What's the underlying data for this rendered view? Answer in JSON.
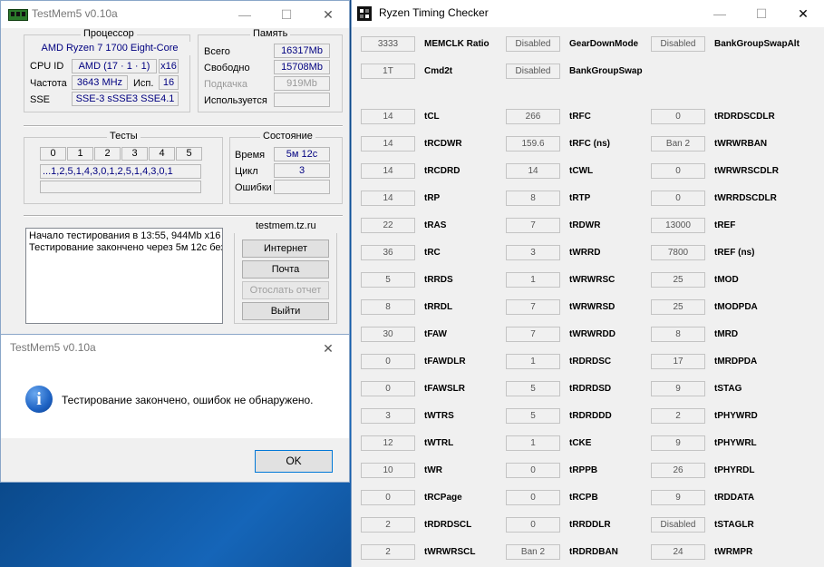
{
  "testmem": {
    "title": "TestMem5 v0.10a",
    "processor": {
      "group_title": "Процессор",
      "name": "AMD Ryzen 7 1700 Eight-Core",
      "cpuid_label": "CPU ID",
      "cpuid_value": "AMD  (17 · 1 · 1)",
      "cores_value": "x16",
      "freq_label": "Частота",
      "freq_value": "3643 MHz",
      "use_label": "Исп.",
      "use_value": "16",
      "sse_label": "SSE",
      "sse_value": "SSE-3 sSSE3 SSE4.1"
    },
    "memory": {
      "group_title": "Память",
      "total_label": "Всего",
      "total_value": "16317Mb",
      "free_label": "Свободно",
      "free_value": "15708Mb",
      "swap_label": "Подкачка",
      "swap_value": "919Mb",
      "used_label": "Используется",
      "used_value": ""
    },
    "tests": {
      "group_title": "Тесты",
      "columns": [
        "0",
        "1",
        "2",
        "3",
        "4",
        "5"
      ],
      "sequence": "...1,2,5,1,4,3,0,1,2,5,1,4,3,0,1"
    },
    "state": {
      "group_title": "Состояние",
      "time_label": "Время",
      "time_value": "5м 12с",
      "cycle_label": "Цикл",
      "cycle_value": "3",
      "errors_label": "Ошибки",
      "errors_value": ""
    },
    "log": [
      "Начало тестирования в 13:55, 944Mb x16",
      "Тестирование закончено через 5м 12с без"
    ],
    "site": {
      "title": "testmem.tz.ru",
      "internet": "Интернет",
      "mail": "Почта",
      "send_report": "Отослать отчет",
      "exit": "Выйти"
    }
  },
  "dialog": {
    "title": "TestMem5 v0.10a",
    "message": "Тестирование закончено, ошибок не обнаружено.",
    "ok": "OK"
  },
  "rtc": {
    "title": "Ryzen Timing Checker",
    "rows": [
      {
        "c": [
          [
            "3333",
            "MEMCLK Ratio"
          ],
          [
            "Disabled",
            "GearDownMode"
          ],
          [
            "Disabled",
            "BankGroupSwapAlt"
          ]
        ]
      },
      {
        "c": [
          [
            "1T",
            "Cmd2t"
          ],
          [
            "Disabled",
            "BankGroupSwap"
          ],
          null
        ]
      },
      {
        "c": [
          [
            "14",
            "tCL"
          ],
          [
            "266",
            "tRFC"
          ],
          [
            "0",
            "tRDRDSCDLR"
          ]
        ]
      },
      {
        "c": [
          [
            "14",
            "tRCDWR"
          ],
          [
            "159.6",
            "tRFC (ns)"
          ],
          [
            "Ban 2",
            "tWRWRBAN"
          ]
        ]
      },
      {
        "c": [
          [
            "14",
            "tRCDRD"
          ],
          [
            "14",
            "tCWL"
          ],
          [
            "0",
            "tWRWRSCDLR"
          ]
        ]
      },
      {
        "c": [
          [
            "14",
            "tRP"
          ],
          [
            "8",
            "tRTP"
          ],
          [
            "0",
            "tWRRDSCDLR"
          ]
        ]
      },
      {
        "c": [
          [
            "22",
            "tRAS"
          ],
          [
            "7",
            "tRDWR"
          ],
          [
            "13000",
            "tREF"
          ]
        ]
      },
      {
        "c": [
          [
            "36",
            "tRC"
          ],
          [
            "3",
            "tWRRD"
          ],
          [
            "7800",
            "tREF (ns)"
          ]
        ]
      },
      {
        "c": [
          [
            "5",
            "tRRDS"
          ],
          [
            "1",
            "tWRWRSC"
          ],
          [
            "25",
            "tMOD"
          ]
        ]
      },
      {
        "c": [
          [
            "8",
            "tRRDL"
          ],
          [
            "7",
            "tWRWRSD"
          ],
          [
            "25",
            "tMODPDA"
          ]
        ]
      },
      {
        "c": [
          [
            "30",
            "tFAW"
          ],
          [
            "7",
            "tWRWRDD"
          ],
          [
            "8",
            "tMRD"
          ]
        ]
      },
      {
        "c": [
          [
            "0",
            "tFAWDLR"
          ],
          [
            "1",
            "tRDRDSC"
          ],
          [
            "17",
            "tMRDPDA"
          ]
        ]
      },
      {
        "c": [
          [
            "0",
            "tFAWSLR"
          ],
          [
            "5",
            "tRDRDSD"
          ],
          [
            "9",
            "tSTAG"
          ]
        ]
      },
      {
        "c": [
          [
            "3",
            "tWTRS"
          ],
          [
            "5",
            "tRDRDDD"
          ],
          [
            "2",
            "tPHYWRD"
          ]
        ]
      },
      {
        "c": [
          [
            "12",
            "tWTRL"
          ],
          [
            "1",
            "tCKE"
          ],
          [
            "9",
            "tPHYWRL"
          ]
        ]
      },
      {
        "c": [
          [
            "10",
            "tWR"
          ],
          [
            "0",
            "tRPPB"
          ],
          [
            "26",
            "tPHYRDL"
          ]
        ]
      },
      {
        "c": [
          [
            "0",
            "tRCPage"
          ],
          [
            "0",
            "tRCPB"
          ],
          [
            "9",
            "tRDDATA"
          ]
        ]
      },
      {
        "c": [
          [
            "2",
            "tRDRDSCL"
          ],
          [
            "0",
            "tRRDDLR"
          ],
          [
            "Disabled",
            "tSTAGLR"
          ]
        ]
      },
      {
        "c": [
          [
            "2",
            "tWRWRSCL"
          ],
          [
            "Ban 2",
            "tRDRDBAN"
          ],
          [
            "24",
            "tWRMPR"
          ]
        ]
      }
    ]
  }
}
